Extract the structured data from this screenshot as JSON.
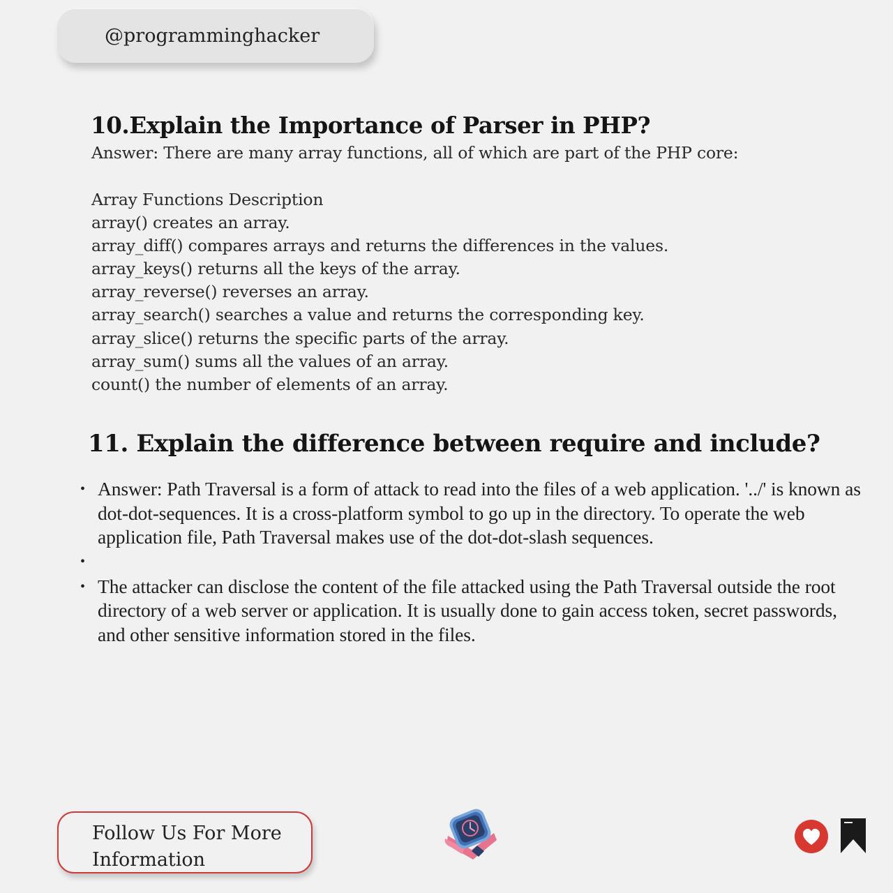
{
  "header": {
    "handle": "@programminghacker"
  },
  "q10": {
    "title": "10.Explain the Importance of Parser in PHP?",
    "answer": "Answer: There are many array functions, all of which are part of the PHP core:",
    "functions": [
      "Array Functions Description",
      "array() creates an array.",
      "array_diff() compares arrays and returns the differences in the values.",
      "array_keys() returns all the keys of the array.",
      "array_reverse() reverses an array.",
      "array_search() searches a value and returns the corresponding key.",
      "array_slice() returns the specific parts of the array.",
      "array_sum() sums all the values of an array.",
      "count() the number of elements of an array."
    ]
  },
  "q11": {
    "title": "11. Explain the difference between require and include?",
    "bullets": [
      "Answer: Path Traversal is a form of attack to read into the files of a web application. '../' is known as dot-dot-sequences. It is a cross-platform symbol to go up in the directory. To operate the web application file, Path Traversal makes use of the dot-dot-slash sequences.",
      "",
      "The attacker can disclose the content of the file attacked using the Path Traversal outside the root directory of a web server or application. It is usually done to gain access token, secret passwords, and other sensitive information stored in the files."
    ]
  },
  "footer": {
    "follow_label": "Follow Us For More Information",
    "center_icon": "smartwatch-icon",
    "like_icon": "heart-icon",
    "save_icon": "bookmark-icon"
  },
  "colors": {
    "background": "#f1f1f1",
    "accent": "#cf3a3a",
    "heart": "#d73830",
    "bookmark": "#1a1a1a"
  }
}
